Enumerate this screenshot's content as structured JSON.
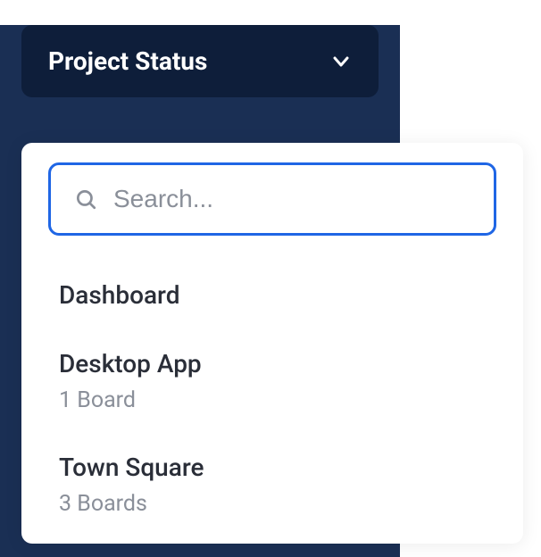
{
  "dropdown": {
    "label": "Project Status"
  },
  "search": {
    "placeholder": "Search...",
    "value": ""
  },
  "items": [
    {
      "title": "Dashboard",
      "subtitle": ""
    },
    {
      "title": "Desktop App",
      "subtitle": "1 Board"
    },
    {
      "title": "Town Square",
      "subtitle": "3 Boards"
    }
  ]
}
